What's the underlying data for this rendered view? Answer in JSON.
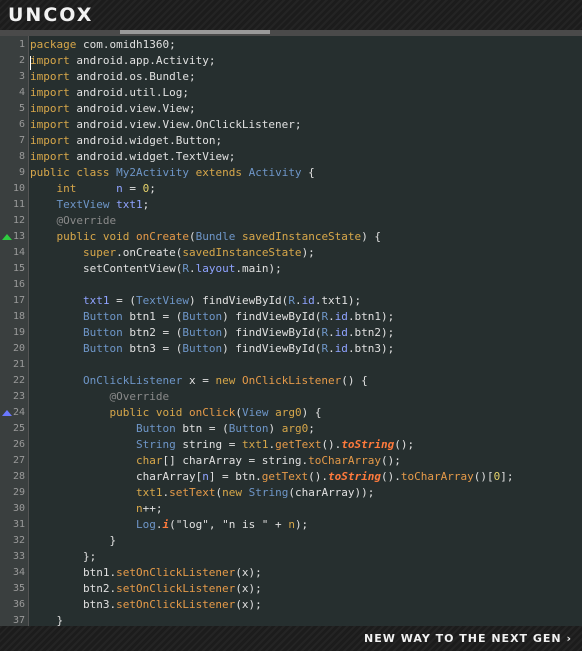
{
  "brand": {
    "logo": "UNCOX",
    "tagline": "NEW WAY TO THE NEXT GEN ›"
  },
  "gutter_markers": [
    {
      "line": 13,
      "icon": "override-up-triangle-icon",
      "color": "#2ecc40"
    },
    {
      "line": 24,
      "icon": "override-triangle-icon",
      "color": "#6a78ff"
    }
  ],
  "colors": {
    "keyword": "#d7a74a",
    "type": "#6e96c8",
    "field": "#8fa3ff",
    "method": "#e59a49",
    "error": "#ff7a3c",
    "annotation": "#8a8a8a",
    "background": "#262f2f"
  },
  "code_lines": [
    {
      "num": "1",
      "tokens": [
        [
          "kw",
          "package"
        ],
        [
          "plain",
          " com.omidh1360;"
        ]
      ]
    },
    {
      "num": "2",
      "tokens": [
        [
          "kw",
          "import"
        ],
        [
          "plain",
          " android.app.Activity;"
        ]
      ]
    },
    {
      "num": "3",
      "tokens": [
        [
          "kw",
          "import"
        ],
        [
          "plain",
          " android.os.Bundle;"
        ]
      ]
    },
    {
      "num": "4",
      "tokens": [
        [
          "kw",
          "import"
        ],
        [
          "plain",
          " android.util.Log;"
        ]
      ]
    },
    {
      "num": "5",
      "tokens": [
        [
          "kw",
          "import"
        ],
        [
          "plain",
          " android.view.View;"
        ]
      ]
    },
    {
      "num": "6",
      "tokens": [
        [
          "kw",
          "import"
        ],
        [
          "plain",
          " android.view.View.OnClickListener;"
        ]
      ]
    },
    {
      "num": "7",
      "tokens": [
        [
          "kw",
          "import"
        ],
        [
          "plain",
          " android.widget.Button;"
        ]
      ]
    },
    {
      "num": "8",
      "tokens": [
        [
          "kw",
          "import"
        ],
        [
          "plain",
          " android.widget.TextView;"
        ]
      ]
    },
    {
      "num": "9",
      "tokens": [
        [
          "kw",
          "public class"
        ],
        [
          "plain",
          " "
        ],
        [
          "type",
          "My2Activity"
        ],
        [
          "plain",
          " "
        ],
        [
          "kw",
          "extends"
        ],
        [
          "plain",
          " "
        ],
        [
          "type",
          "Activity"
        ],
        [
          "plain",
          " {"
        ]
      ]
    },
    {
      "num": "10",
      "tokens": [
        [
          "plain",
          "    "
        ],
        [
          "kw",
          "int"
        ],
        [
          "plain",
          "      "
        ],
        [
          "field",
          "n"
        ],
        [
          "plain",
          " = "
        ],
        [
          "num",
          "0"
        ],
        [
          "plain",
          ";"
        ]
      ]
    },
    {
      "num": "11",
      "tokens": [
        [
          "plain",
          "    "
        ],
        [
          "type",
          "TextView"
        ],
        [
          "plain",
          " "
        ],
        [
          "field",
          "txt1"
        ],
        [
          "plain",
          ";"
        ]
      ]
    },
    {
      "num": "12",
      "tokens": [
        [
          "plain",
          "    "
        ],
        [
          "ann",
          "@Override"
        ]
      ]
    },
    {
      "num": "13",
      "tokens": [
        [
          "plain",
          "    "
        ],
        [
          "kw",
          "public void"
        ],
        [
          "plain",
          " "
        ],
        [
          "fn",
          "onCreate"
        ],
        [
          "plain",
          "("
        ],
        [
          "type",
          "Bundle"
        ],
        [
          "plain",
          " "
        ],
        [
          "kw",
          "savedInstanceState"
        ],
        [
          "plain",
          ") {"
        ]
      ]
    },
    {
      "num": "14",
      "tokens": [
        [
          "plain",
          "        "
        ],
        [
          "kw",
          "super"
        ],
        [
          "plain",
          "."
        ],
        [
          "plain",
          "onCreate("
        ],
        [
          "kw",
          "savedInstanceState"
        ],
        [
          "plain",
          ");"
        ]
      ]
    },
    {
      "num": "15",
      "tokens": [
        [
          "plain",
          "        setContentView("
        ],
        [
          "type",
          "R"
        ],
        [
          "plain",
          "."
        ],
        [
          "field",
          "layout"
        ],
        [
          "plain",
          ".main);"
        ]
      ]
    },
    {
      "num": "16",
      "tokens": [
        [
          "plain",
          ""
        ]
      ]
    },
    {
      "num": "17",
      "tokens": [
        [
          "plain",
          "        "
        ],
        [
          "field",
          "txt1"
        ],
        [
          "plain",
          " = ("
        ],
        [
          "type",
          "TextView"
        ],
        [
          "plain",
          ") findViewById("
        ],
        [
          "type",
          "R"
        ],
        [
          "plain",
          "."
        ],
        [
          "field",
          "id"
        ],
        [
          "plain",
          ".txt1);"
        ]
      ]
    },
    {
      "num": "18",
      "tokens": [
        [
          "plain",
          "        "
        ],
        [
          "type",
          "Button"
        ],
        [
          "plain",
          " btn1 = ("
        ],
        [
          "type",
          "Button"
        ],
        [
          "plain",
          ") findViewById("
        ],
        [
          "type",
          "R"
        ],
        [
          "plain",
          "."
        ],
        [
          "field",
          "id"
        ],
        [
          "plain",
          ".btn1);"
        ]
      ]
    },
    {
      "num": "19",
      "tokens": [
        [
          "plain",
          "        "
        ],
        [
          "type",
          "Button"
        ],
        [
          "plain",
          " btn2 = ("
        ],
        [
          "type",
          "Button"
        ],
        [
          "plain",
          ") findViewById("
        ],
        [
          "type",
          "R"
        ],
        [
          "plain",
          "."
        ],
        [
          "field",
          "id"
        ],
        [
          "plain",
          ".btn2);"
        ]
      ]
    },
    {
      "num": "20",
      "tokens": [
        [
          "plain",
          "        "
        ],
        [
          "type",
          "Button"
        ],
        [
          "plain",
          " btn3 = ("
        ],
        [
          "type",
          "Button"
        ],
        [
          "plain",
          ") findViewById("
        ],
        [
          "type",
          "R"
        ],
        [
          "plain",
          "."
        ],
        [
          "field",
          "id"
        ],
        [
          "plain",
          ".btn3);"
        ]
      ]
    },
    {
      "num": "21",
      "tokens": [
        [
          "plain",
          ""
        ]
      ]
    },
    {
      "num": "22",
      "tokens": [
        [
          "plain",
          "        "
        ],
        [
          "type",
          "OnClickListener"
        ],
        [
          "plain",
          " x = "
        ],
        [
          "kw",
          "new"
        ],
        [
          "plain",
          " "
        ],
        [
          "fn",
          "OnClickListener"
        ],
        [
          "plain",
          "() {"
        ]
      ]
    },
    {
      "num": "23",
      "tokens": [
        [
          "plain",
          "            "
        ],
        [
          "ann",
          "@Override"
        ]
      ]
    },
    {
      "num": "24",
      "tokens": [
        [
          "plain",
          "            "
        ],
        [
          "kw",
          "public void"
        ],
        [
          "plain",
          " "
        ],
        [
          "fn",
          "onClick"
        ],
        [
          "plain",
          "("
        ],
        [
          "type",
          "View"
        ],
        [
          "plain",
          " "
        ],
        [
          "kw",
          "arg0"
        ],
        [
          "plain",
          ") {"
        ]
      ]
    },
    {
      "num": "25",
      "tokens": [
        [
          "plain",
          "                "
        ],
        [
          "type",
          "Button"
        ],
        [
          "plain",
          " btn = ("
        ],
        [
          "type",
          "Button"
        ],
        [
          "plain",
          ") "
        ],
        [
          "kw",
          "arg0"
        ],
        [
          "plain",
          ";"
        ]
      ]
    },
    {
      "num": "26",
      "tokens": [
        [
          "plain",
          "                "
        ],
        [
          "type",
          "String"
        ],
        [
          "plain",
          " string = "
        ],
        [
          "kw",
          "txt1"
        ],
        [
          "plain",
          "."
        ],
        [
          "fn",
          "getText"
        ],
        [
          "plain",
          "()."
        ],
        [
          "err",
          "toString"
        ],
        [
          "plain",
          "();"
        ]
      ]
    },
    {
      "num": "27",
      "tokens": [
        [
          "plain",
          "                "
        ],
        [
          "kw",
          "char"
        ],
        [
          "plain",
          "[] charArray = string."
        ],
        [
          "fn",
          "toCharArray"
        ],
        [
          "plain",
          "();"
        ]
      ]
    },
    {
      "num": "28",
      "tokens": [
        [
          "plain",
          "                charArray["
        ],
        [
          "field",
          "n"
        ],
        [
          "plain",
          "] = btn."
        ],
        [
          "fn",
          "getText"
        ],
        [
          "plain",
          "()."
        ],
        [
          "err",
          "toString"
        ],
        [
          "plain",
          "()."
        ],
        [
          "fn",
          "toCharArray"
        ],
        [
          "plain",
          "()["
        ],
        [
          "num",
          "0"
        ],
        [
          "plain",
          "];"
        ]
      ]
    },
    {
      "num": "29",
      "tokens": [
        [
          "plain",
          "                "
        ],
        [
          "kw",
          "txt1"
        ],
        [
          "plain",
          "."
        ],
        [
          "fn",
          "setText"
        ],
        [
          "plain",
          "("
        ],
        [
          "kw",
          "new"
        ],
        [
          "plain",
          " "
        ],
        [
          "type",
          "String"
        ],
        [
          "plain",
          "(charArray));"
        ]
      ]
    },
    {
      "num": "30",
      "tokens": [
        [
          "plain",
          "                "
        ],
        [
          "kw",
          "n"
        ],
        [
          "plain",
          "++;"
        ]
      ]
    },
    {
      "num": "31",
      "tokens": [
        [
          "plain",
          "                "
        ],
        [
          "type",
          "Log"
        ],
        [
          "plain",
          "."
        ],
        [
          "err",
          "i"
        ],
        [
          "plain",
          "(\"log\", \"n is \" + "
        ],
        [
          "kw",
          "n"
        ],
        [
          "plain",
          ");"
        ]
      ]
    },
    {
      "num": "32",
      "tokens": [
        [
          "plain",
          "            }"
        ]
      ]
    },
    {
      "num": "33",
      "tokens": [
        [
          "plain",
          "        };"
        ]
      ]
    },
    {
      "num": "34",
      "tokens": [
        [
          "plain",
          "        btn1."
        ],
        [
          "fn",
          "setOnClickListener"
        ],
        [
          "plain",
          "(x);"
        ]
      ]
    },
    {
      "num": "35",
      "tokens": [
        [
          "plain",
          "        btn2."
        ],
        [
          "fn",
          "setOnClickListener"
        ],
        [
          "plain",
          "(x);"
        ]
      ]
    },
    {
      "num": "36",
      "tokens": [
        [
          "plain",
          "        btn3."
        ],
        [
          "fn",
          "setOnClickListener"
        ],
        [
          "plain",
          "(x);"
        ]
      ]
    },
    {
      "num": "37",
      "tokens": [
        [
          "plain",
          "    }"
        ]
      ]
    }
  ]
}
